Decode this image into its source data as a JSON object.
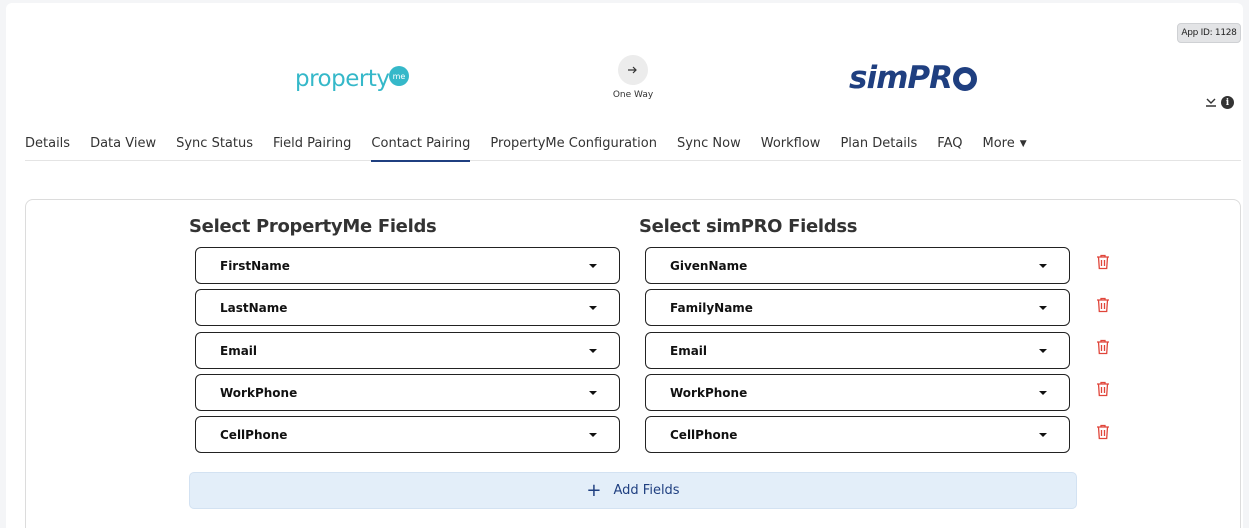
{
  "header": {
    "app_id": "App ID: 1128",
    "left_logo": "property",
    "left_logo_badge": "me",
    "sync_direction": "One Way",
    "sync_icon": "arrow-right-icon",
    "right_logo": "simPR"
  },
  "tabs": [
    {
      "label": "Details"
    },
    {
      "label": "Data View"
    },
    {
      "label": "Sync Status"
    },
    {
      "label": "Field Pairing"
    },
    {
      "label": "Contact Pairing",
      "active": true
    },
    {
      "label": "PropertyMe Configuration"
    },
    {
      "label": "Sync Now"
    },
    {
      "label": "Workflow"
    },
    {
      "label": "Plan Details"
    },
    {
      "label": "FAQ"
    },
    {
      "label": "More"
    }
  ],
  "mapping": {
    "left_title": "Select PropertyMe Fields",
    "right_title": "Select simPRO Fieldss",
    "rows": [
      {
        "left": "FirstName",
        "right": "GivenName"
      },
      {
        "left": "LastName",
        "right": "FamilyName"
      },
      {
        "left": "Email",
        "right": "Email"
      },
      {
        "left": "WorkPhone",
        "right": "WorkPhone"
      },
      {
        "left": "CellPhone",
        "right": "CellPhone"
      }
    ],
    "add_label": "Add Fields"
  },
  "colors": {
    "propertyme": "#35b8c9",
    "simpro": "#1f3f80",
    "delete": "#e0453a",
    "add_bg": "#e3eef9"
  }
}
